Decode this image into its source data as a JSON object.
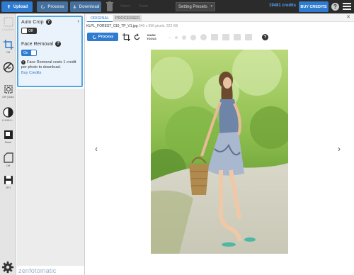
{
  "topbar": {
    "upload_label": "Upload",
    "process_label": "Process",
    "download_label": "Download",
    "dim1": "Select",
    "dim2": "Zoom",
    "preset_label": "Setting Presets",
    "credits": "19481 credits",
    "buy_label": "BUY CREDITS",
    "help": "?"
  },
  "leftbar": {
    "tools": [
      {
        "name": "crop-tool",
        "label": "Off"
      },
      {
        "name": "face-removal-tool",
        "label": "On"
      },
      {
        "name": "auto-tool",
        "label": "Off | Auto"
      },
      {
        "name": "contrast-tool",
        "label": "0:100:0..."
      },
      {
        "name": "shadow-tool",
        "label": "None"
      },
      {
        "name": "shape-tool",
        "label": "Off"
      },
      {
        "name": "save-format-tool",
        "label": "JPG"
      }
    ],
    "top_label": "Crop/Res"
  },
  "panel": {
    "auto_crop_title": "Auto Crop",
    "auto_crop_state": "Off",
    "face_removal_title": "Face Removal",
    "face_removal_state": "On",
    "info_text": "Face Removal costs 1 credit per photo to download.",
    "buy_link": "Buy Credits"
  },
  "viewer": {
    "tab_original": "ORIGINAL",
    "tab_processed": "PROCESSED",
    "filename": "KLPL_FOREST_010_TP_V1.jpg",
    "file_meta": "640 x 956 pixels, 222 KB",
    "process_label": "Process",
    "mask_tools": "MASK TOOLS",
    "help": "?"
  },
  "footer": {
    "brand": "zenfotomatic"
  },
  "colors": {
    "accent": "#2f7bd0",
    "topbar": "#2b2b2b",
    "panel_bg": "#eaf3fb",
    "panel_border": "#55a5e0"
  }
}
